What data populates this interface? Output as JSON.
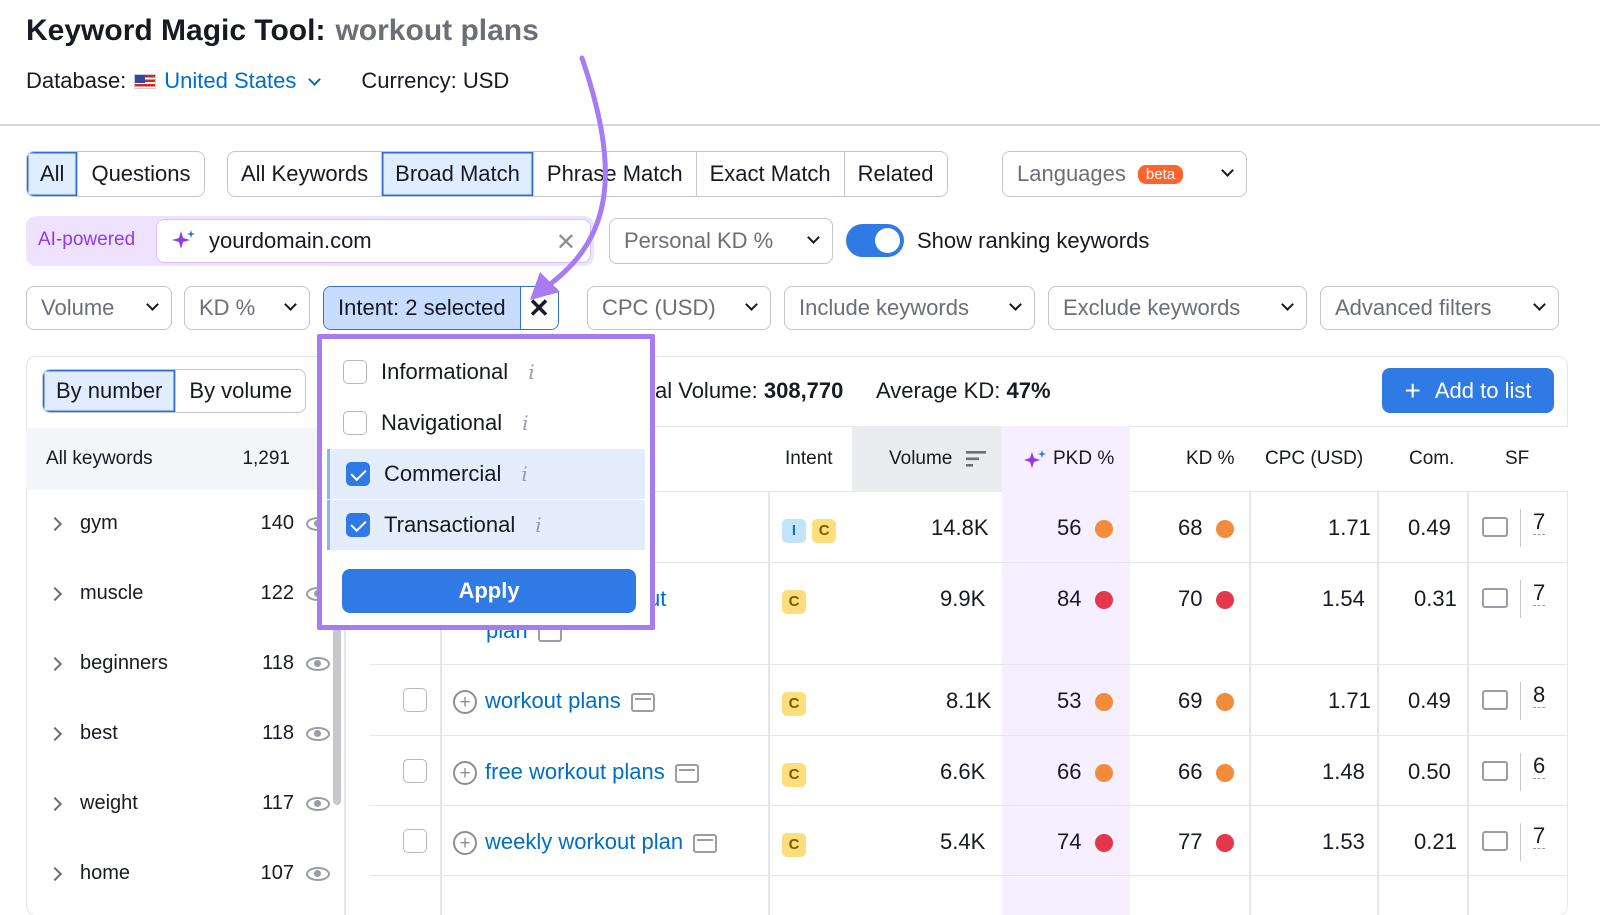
{
  "header": {
    "tool_title": "Keyword Magic Tool:",
    "query": "workout plans",
    "database_label": "Database:",
    "database_value": "United States",
    "currency": "Currency: USD"
  },
  "tabs_group1": [
    "All",
    "Questions"
  ],
  "tabs_group2": [
    "All Keywords",
    "Broad Match",
    "Phrase Match",
    "Exact Match",
    "Related"
  ],
  "languages": {
    "label": "Languages",
    "badge": "beta"
  },
  "ai": {
    "label": "AI-powered",
    "domain": "yourdomain.com",
    "clear": "✕"
  },
  "personal_kd": "Personal KD %",
  "show_ranking": "Show ranking keywords",
  "filters": {
    "volume": "Volume",
    "kd": "KD %",
    "intent": "Intent: 2 selected",
    "cpc": "CPC (USD)",
    "include": "Include keywords",
    "exclude": "Exclude keywords",
    "advanced": "Advanced filters"
  },
  "intent_menu": {
    "options": [
      {
        "label": "Informational",
        "checked": false
      },
      {
        "label": "Navigational",
        "checked": false
      },
      {
        "label": "Commercial",
        "checked": true
      },
      {
        "label": "Transactional",
        "checked": true
      }
    ],
    "apply": "Apply"
  },
  "sidebar": {
    "by_number": "By number",
    "by_volume": "By volume",
    "all_keywords": "All keywords",
    "all_count": "1,291",
    "groups": [
      {
        "name": "gym",
        "count": "140"
      },
      {
        "name": "muscle",
        "count": "122"
      },
      {
        "name": "beginners",
        "count": "118"
      },
      {
        "name": "best",
        "count": "118"
      },
      {
        "name": "weight",
        "count": "117"
      },
      {
        "name": "home",
        "count": "107"
      }
    ]
  },
  "summary": {
    "volume_label": "al Volume:",
    "volume_value": "308,770",
    "kd_label": "Average KD:",
    "kd_value": "47%"
  },
  "add_to_list": "Add to list",
  "table": {
    "headers": {
      "intent": "Intent",
      "volume": "Volume",
      "pkd": "PKD %",
      "kd": "KD %",
      "cpc": "CPC (USD)",
      "com": "Com.",
      "sf": "SF"
    },
    "rows": [
      {
        "keyword": "",
        "intents": [
          "I",
          "C"
        ],
        "volume": "14.8K",
        "pkd": "56",
        "pkd_color": "#f28c3a",
        "kd": "68",
        "kd_color": "#f28c3a",
        "cpc": "1.71",
        "com": "0.49",
        "sf": "7"
      },
      {
        "keyword": "ut",
        "keyword2": "plan",
        "intents": [
          "C"
        ],
        "volume": "9.9K",
        "pkd": "84",
        "pkd_color": "#e5374a",
        "kd": "70",
        "kd_color": "#e5374a",
        "cpc": "1.54",
        "com": "0.31",
        "sf": "7"
      },
      {
        "keyword": "workout plans",
        "intents": [
          "C"
        ],
        "volume": "8.1K",
        "pkd": "53",
        "pkd_color": "#f28c3a",
        "kd": "69",
        "kd_color": "#f28c3a",
        "cpc": "1.71",
        "com": "0.49",
        "sf": "8"
      },
      {
        "keyword": "free workout plans",
        "intents": [
          "C"
        ],
        "volume": "6.6K",
        "pkd": "66",
        "pkd_color": "#f28c3a",
        "kd": "66",
        "kd_color": "#f28c3a",
        "cpc": "1.48",
        "com": "0.50",
        "sf": "6"
      },
      {
        "keyword": "weekly workout plan",
        "intents": [
          "C"
        ],
        "volume": "5.4K",
        "pkd": "74",
        "pkd_color": "#e5374a",
        "kd": "77",
        "kd_color": "#e5374a",
        "cpc": "1.53",
        "com": "0.21",
        "sf": "7"
      }
    ]
  }
}
